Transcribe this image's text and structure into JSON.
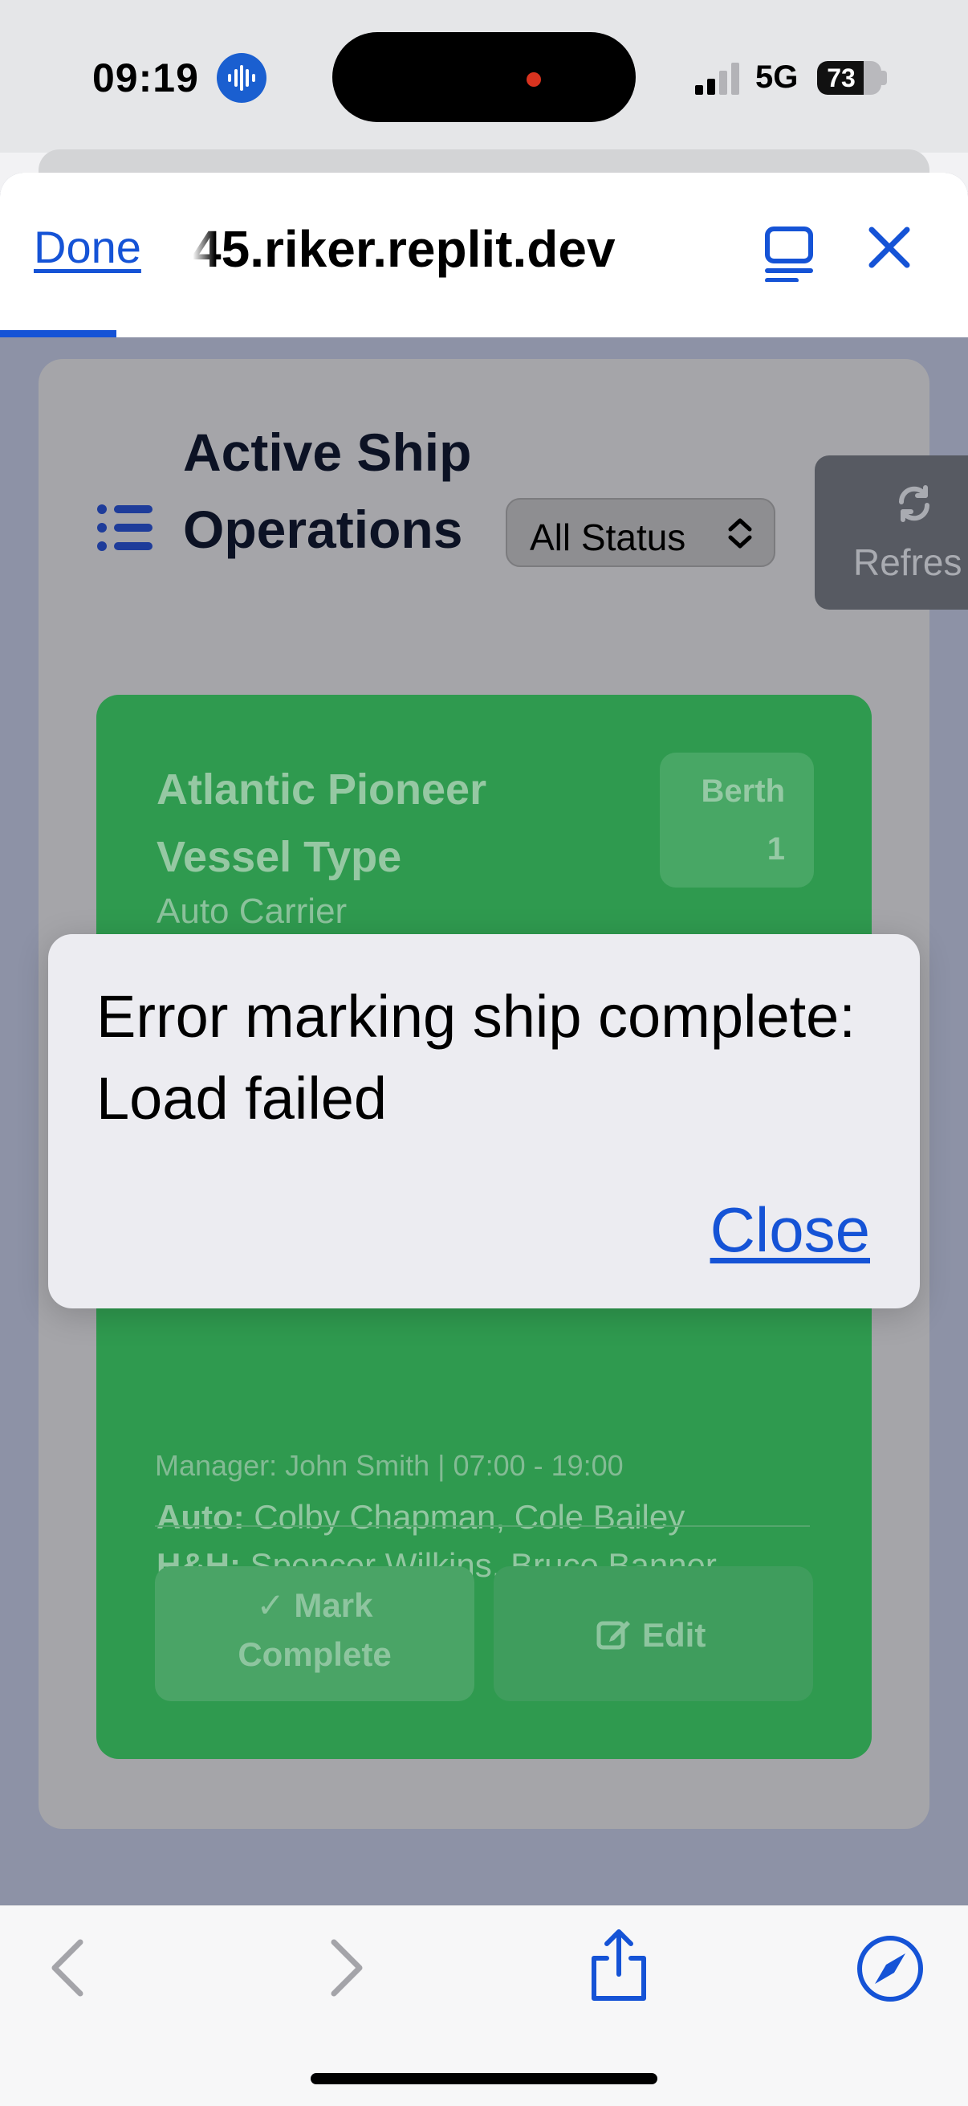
{
  "status_bar": {
    "time": "09:19",
    "network": "5G",
    "battery": "73",
    "battery_level": 0.73
  },
  "browser": {
    "done_label": "Done",
    "url": "45.riker.replit.dev",
    "accent_color": "#1553d6"
  },
  "page": {
    "title": "Active Ship Operations",
    "status_filter": "All Status",
    "refresh_label": "Refres",
    "ship": {
      "name": "Atlantic Pioneer Vessel Type",
      "vessel_type": "Auto Carrier",
      "berth_label": "Berth",
      "berth_number": "1",
      "auto_label": "Auto:",
      "auto_crew": " Colby Chapman, Cole Bailey",
      "hh_label": "H&H:",
      "hh_crew": " Spencer Wilkins, Bruce Banner",
      "manager": "Manager: John Smith | 07:00 - 19:00",
      "mark_complete_line1": "Mark",
      "mark_complete_line2": "Complete",
      "edit_label": "Edit",
      "card_color": "#2f9a4f"
    }
  },
  "dialog": {
    "message": "Error marking ship complete: Load failed",
    "close_label": "Close"
  }
}
